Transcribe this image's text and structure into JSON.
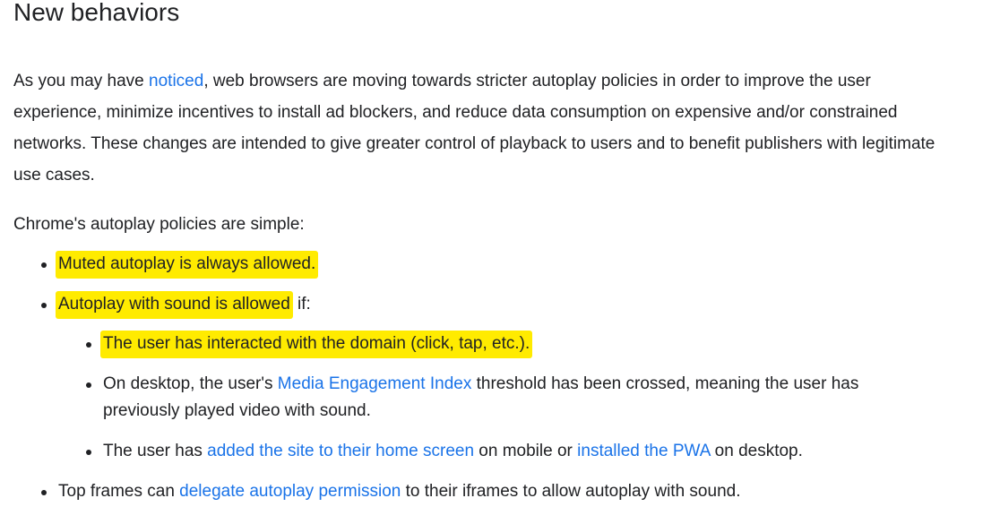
{
  "heading": "New behaviors",
  "intro": {
    "before_link": "As you may have ",
    "link": "noticed",
    "after_link": ", web browsers are moving towards stricter autoplay policies in order to improve the user experience, minimize incentives to install ad blockers, and reduce data consumption on expensive and/or constrained networks. These changes are intended to give greater control of playback to users and to benefit publishers with legitimate use cases."
  },
  "policies_lead": "Chrome's autoplay policies are simple:",
  "policies": {
    "muted": "Muted autoplay is always allowed.",
    "sound_highlight": "Autoplay with sound is allowed",
    "sound_tail": " if:",
    "conditions": {
      "interacted": "The user has interacted with the domain (click, tap, etc.).",
      "mei_before": "On desktop, the user's ",
      "mei_link": "Media Engagement Index",
      "mei_after": " threshold has been crossed, meaning the user has previously played video with sound.",
      "pwa_before": "The user has ",
      "pwa_link1": "added the site to their home screen",
      "pwa_middle": " on mobile or ",
      "pwa_link2": "installed the PWA",
      "pwa_after": " on desktop."
    },
    "frames_before": "Top frames can ",
    "frames_link": "delegate autoplay permission",
    "frames_after": " to their iframes to allow autoplay with sound."
  },
  "colors": {
    "text": "#202124",
    "link": "#1a73e8",
    "highlight": "#ffeb00"
  }
}
